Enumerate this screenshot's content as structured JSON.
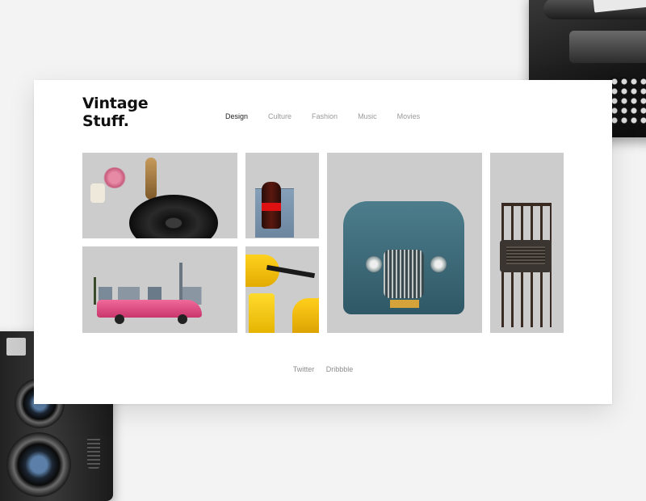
{
  "logo": {
    "line1": "Vintage",
    "line2": "Stuff."
  },
  "nav": {
    "items": [
      {
        "label": "Design",
        "active": true
      },
      {
        "label": "Culture",
        "active": false
      },
      {
        "label": "Fashion",
        "active": false
      },
      {
        "label": "Music",
        "active": false
      },
      {
        "label": "Movies",
        "active": false
      }
    ]
  },
  "gallery": {
    "tiles": [
      {
        "subject": "record player with vinyl and flowers"
      },
      {
        "subject": "coca-cola bottle in jeans pocket"
      },
      {
        "subject": "old blue truck in vineyard"
      },
      {
        "subject": "vintage radio on wooden chair in field"
      },
      {
        "subject": "pink convertible cadillac with city skyline"
      },
      {
        "subject": "yellow vintage scooter"
      }
    ]
  },
  "footer": {
    "links": [
      "Twitter",
      "Dribbble"
    ]
  },
  "colors": {
    "card": "#ffffff",
    "background": "#f3f3f3",
    "nav_active": "#222222",
    "nav_inactive": "#9a9a9a"
  }
}
